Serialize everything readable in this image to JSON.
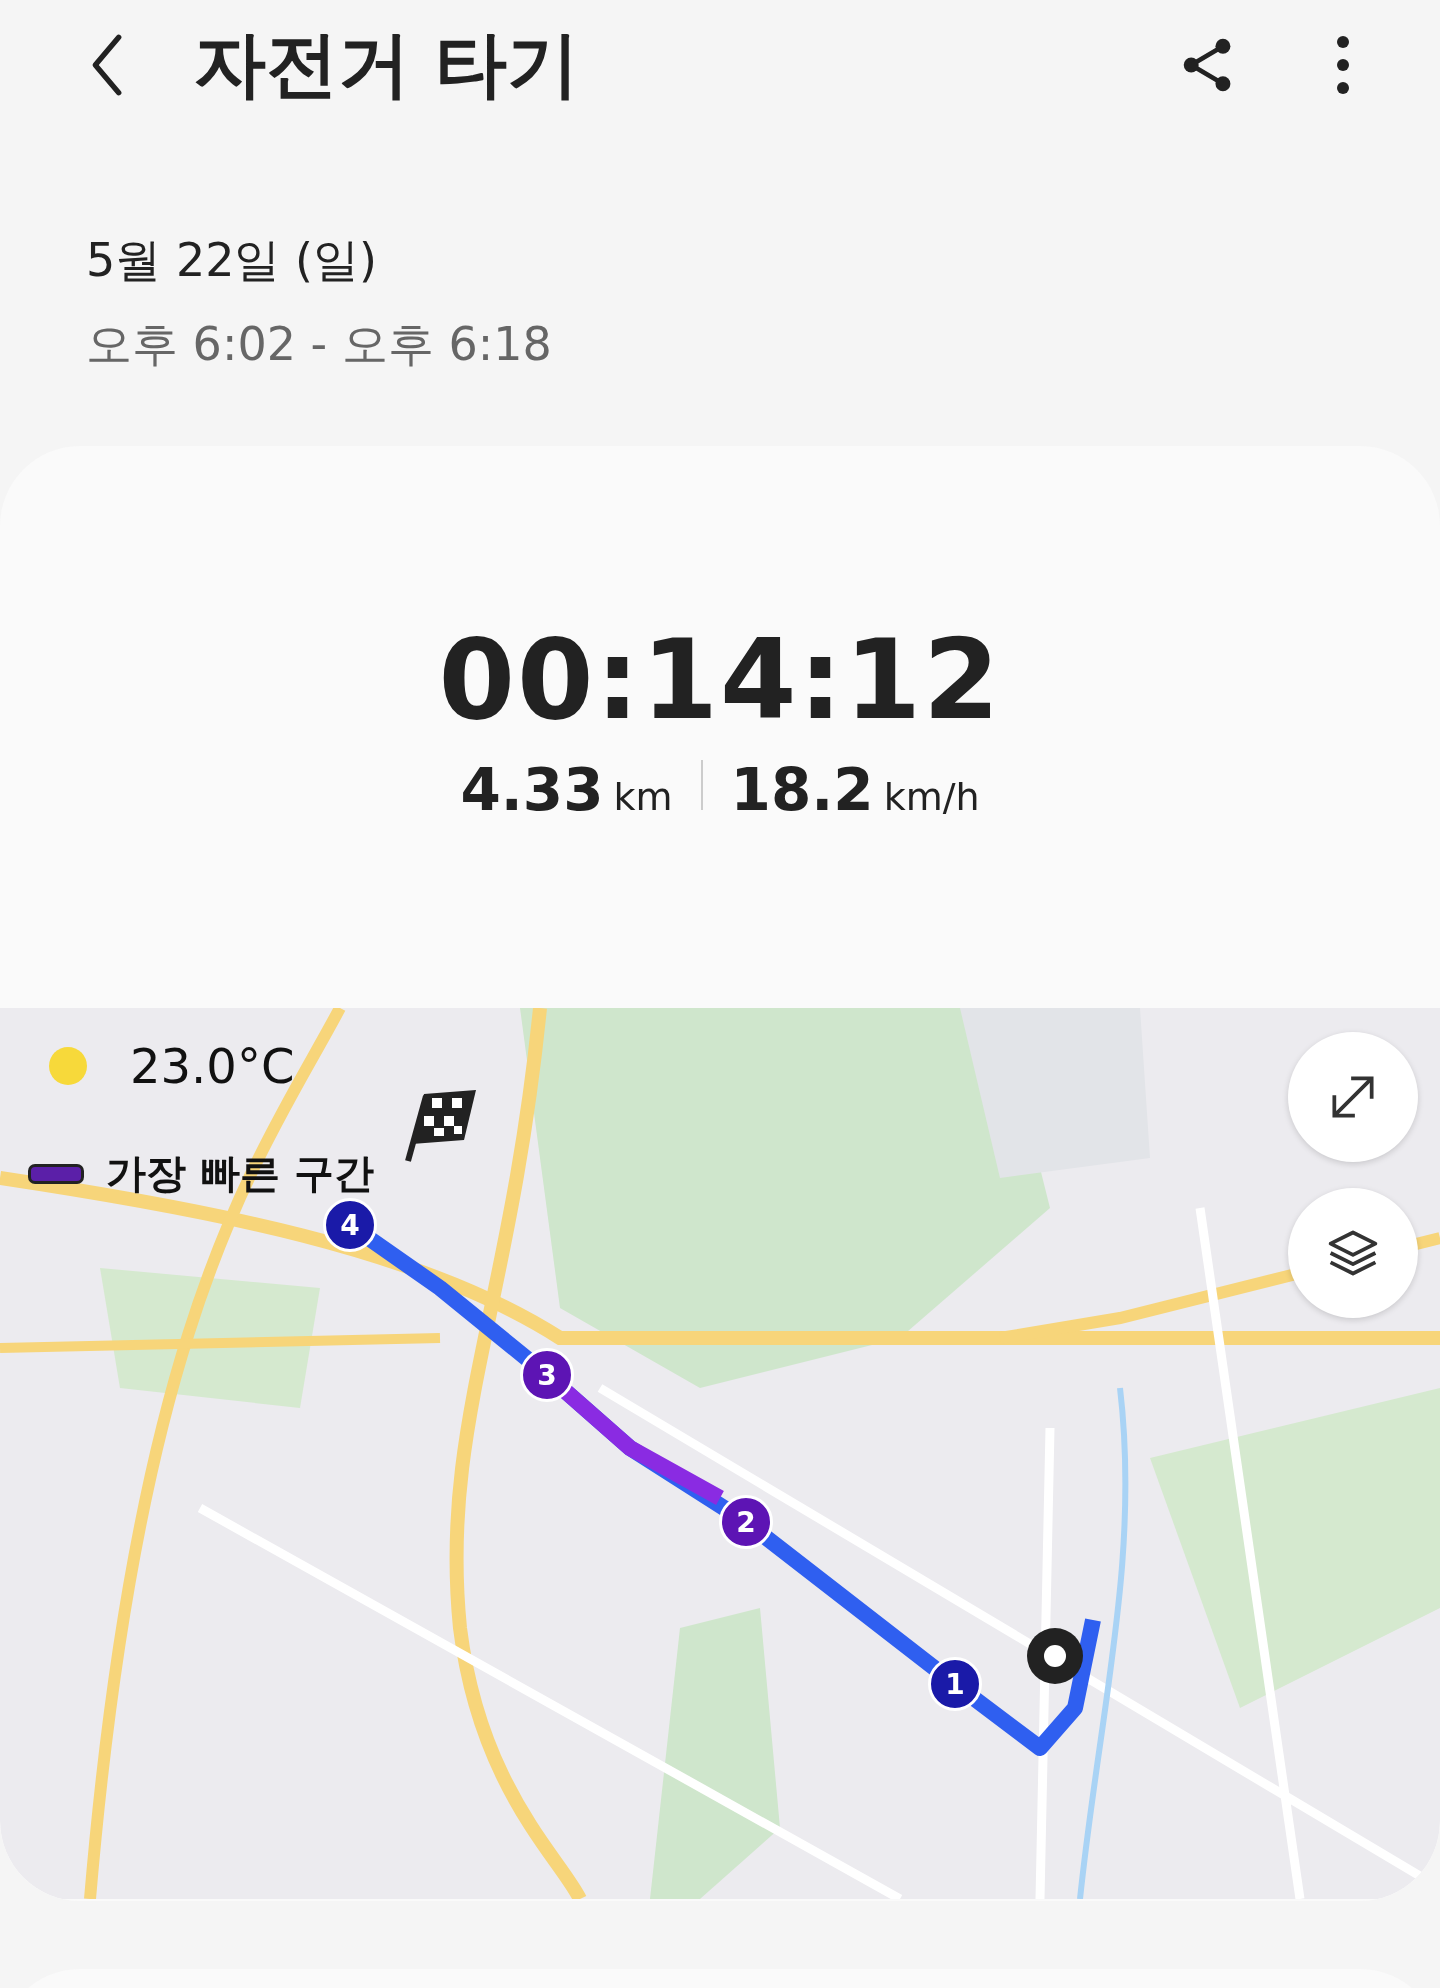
{
  "header": {
    "title": "자전거 타기"
  },
  "session": {
    "date": "5월 22일 (일)",
    "time_range": "오후 6:02 - 오후 6:18"
  },
  "summary": {
    "duration": "00:14:12",
    "stats": [
      {
        "value": "4.33",
        "unit": "km"
      },
      {
        "value": "18.2",
        "unit": "km/h"
      }
    ]
  },
  "map": {
    "weather": {
      "temperature": "23.0°C"
    },
    "legend": {
      "label": "가장 빠른 구간",
      "color": "#5b1fa8"
    },
    "markers": [
      {
        "label": "4",
        "color": "#1a1aa8"
      },
      {
        "label": "3",
        "color": "#5d14b4"
      },
      {
        "label": "2",
        "color": "#5d14b4"
      },
      {
        "label": "1",
        "color": "#1a1aa8"
      }
    ]
  }
}
